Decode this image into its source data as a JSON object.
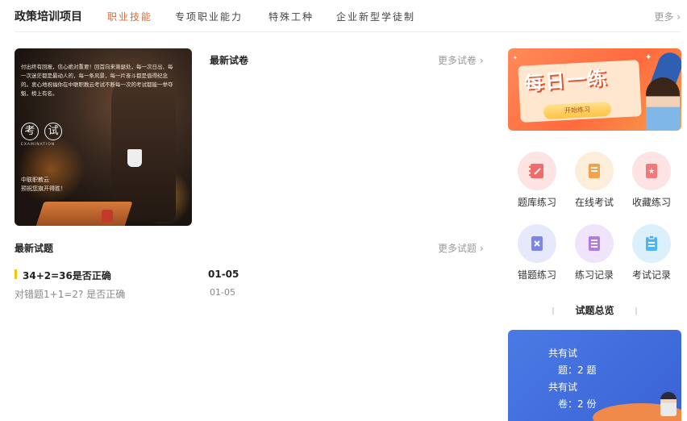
{
  "nav": {
    "brand": "政策培训项目",
    "tabs": [
      {
        "label": "职业技能",
        "active": true
      },
      {
        "label": "专项职业能力",
        "active": false
      },
      {
        "label": "特殊工种",
        "active": false
      },
      {
        "label": "企业新型学徒制",
        "active": false
      }
    ],
    "more": "更多 ›"
  },
  "banner": {
    "text": "付出终有回报，信心绝对重要！回首向来萧瑟处，每一次日出、每一次迷茫都是最动人的，每一条风景，每一片奋斗都是值得纪念的。衷心地祝福你在中联职教云考试不断每一次的考试都能一举夺魁，榜上有名。",
    "exam_char1": "考",
    "exam_char2": "试",
    "exam_sub": "EXAMINATION",
    "blessing_line1": "中联职教云",
    "blessing_line2": "预祝您旗开得胜！"
  },
  "papers": {
    "title": "最新试卷",
    "more": "更多试卷 ›"
  },
  "questions": {
    "title": "最新试题",
    "more": "更多试题 ›",
    "items": [
      {
        "title": "34+2=36是否正确",
        "date": "01-05"
      },
      {
        "title": "对错题1+1=2? 是否正确",
        "date": "01-05"
      }
    ]
  },
  "daily": {
    "title": "每日一练",
    "button": "开始练习"
  },
  "shortcuts": [
    {
      "label": "题库练习",
      "icon": "question-bank-icon",
      "bg": "#fde3e3",
      "fg": "#f06b6b"
    },
    {
      "label": "在线考试",
      "icon": "online-exam-icon",
      "bg": "#fdeedb",
      "fg": "#f3a24b"
    },
    {
      "label": "收藏练习",
      "icon": "favorite-practice-icon",
      "bg": "#fde3e3",
      "fg": "#f07a7a"
    },
    {
      "label": "错题练习",
      "icon": "wrong-question-icon",
      "bg": "#e6e8fb",
      "fg": "#7c84e8"
    },
    {
      "label": "练习记录",
      "icon": "practice-record-icon",
      "bg": "#efe4fb",
      "fg": "#b27ae8"
    },
    {
      "label": "考试记录",
      "icon": "exam-record-icon",
      "bg": "#dcf0fb",
      "fg": "#4eb6ee"
    }
  ],
  "overview": {
    "title": "试题总览",
    "q_label_a": "共有试",
    "q_label_b": "题：2 题",
    "p_label_a": "共有试",
    "p_label_b": "卷：2 份"
  }
}
